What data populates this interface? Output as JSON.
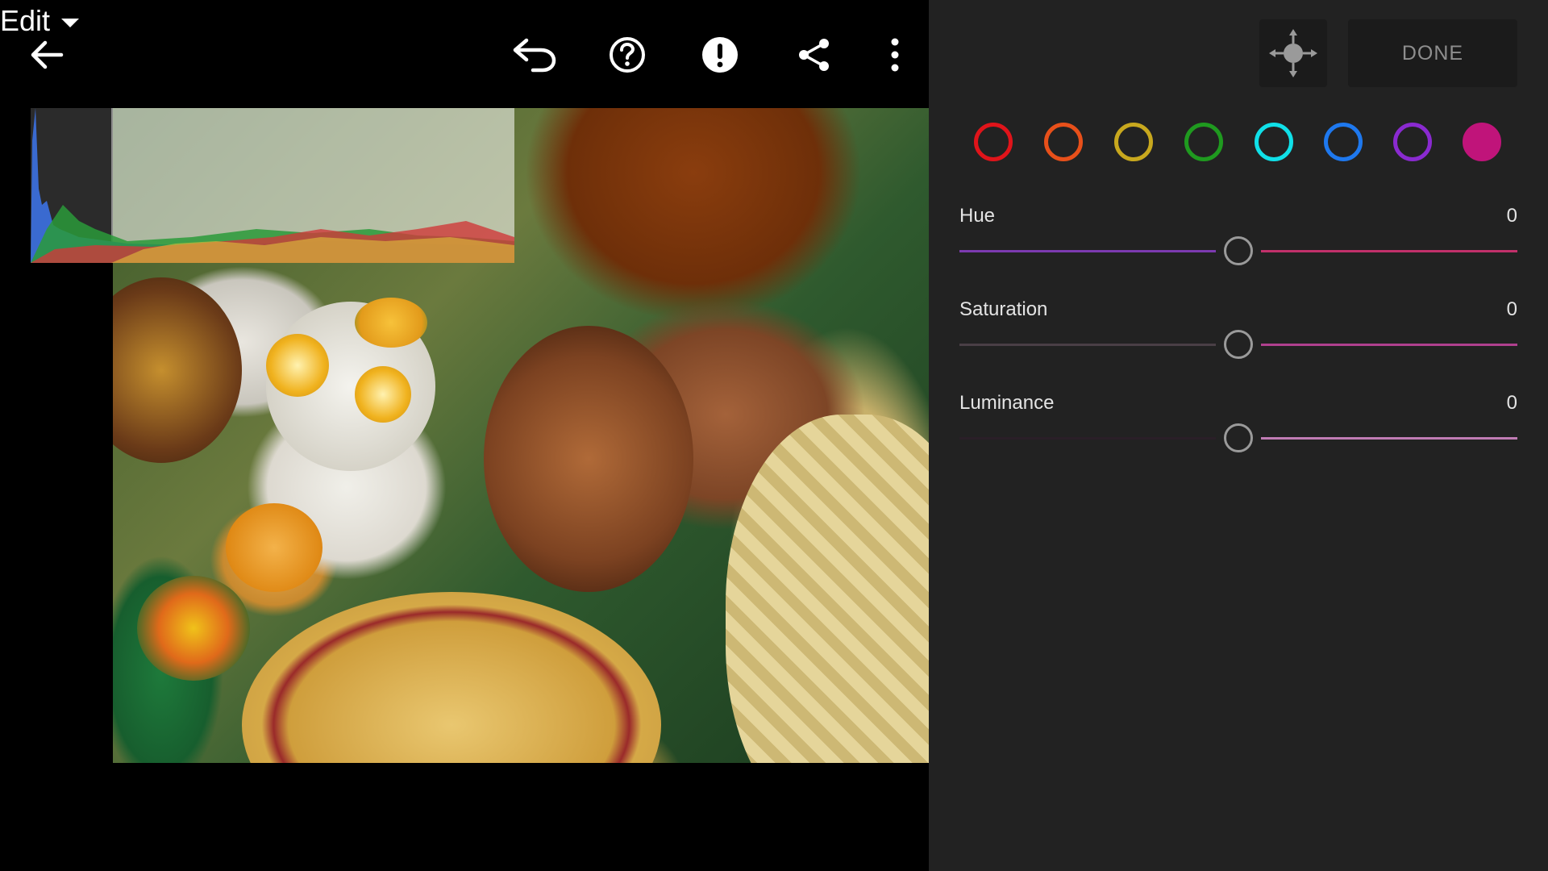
{
  "topbar": {
    "back_icon": "arrow-left-icon",
    "edit_label": "Edit",
    "undo_icon": "undo-icon",
    "help_icon": "help-circle-icon",
    "alert_icon": "alert-circle-icon",
    "share_icon": "share-icon",
    "more_icon": "more-vertical-icon"
  },
  "panel": {
    "target_icon": "target-adjustment-icon",
    "done_label": "DONE",
    "swatches": [
      {
        "name": "red",
        "color": "#e0141a"
      },
      {
        "name": "orange",
        "color": "#e8501a"
      },
      {
        "name": "yellow",
        "color": "#c8a81e"
      },
      {
        "name": "green",
        "color": "#1f9a1f"
      },
      {
        "name": "aqua",
        "color": "#10e0e8"
      },
      {
        "name": "blue",
        "color": "#1e78ee"
      },
      {
        "name": "purple",
        "color": "#8a2ad0"
      },
      {
        "name": "magenta",
        "color": "#c0147a",
        "selected": true
      }
    ],
    "sliders": [
      {
        "label": "Hue",
        "value": "0",
        "left_color": "#7c3ab0",
        "right_color": "#c2306a"
      },
      {
        "label": "Saturation",
        "value": "0",
        "left_color": "#4a3f46",
        "right_color": "#b0408e"
      },
      {
        "label": "Luminance",
        "value": "0",
        "left_color": "#2a1f28",
        "right_color": "#c07cb4"
      }
    ]
  }
}
